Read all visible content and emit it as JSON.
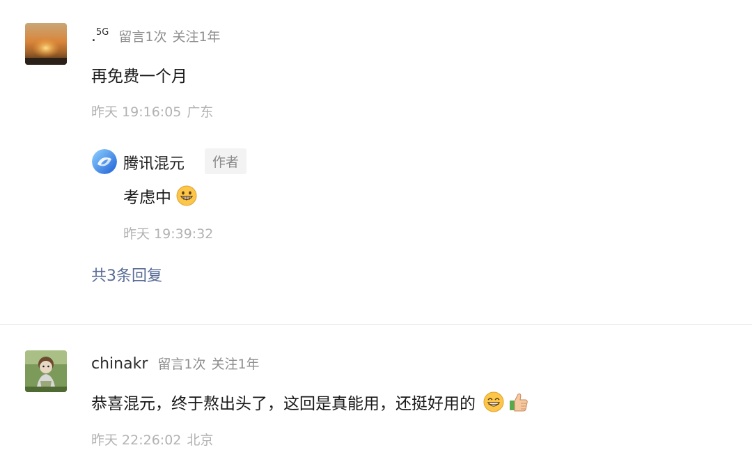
{
  "comments": [
    {
      "nickname": ".",
      "nickname_sup": "5G",
      "msg_count": "留言1次",
      "follow": "关注1年",
      "content": "再免费一个月",
      "time": "昨天 19:16:05",
      "location": "广东",
      "reply": {
        "name": "腾讯混元",
        "tag": "作者",
        "content": "考虑中",
        "emoji": "grinning-face-emoji",
        "time": "昨天 19:39:32"
      },
      "more_replies": "共3条回复"
    },
    {
      "nickname": "chinakr",
      "msg_count": "留言1次",
      "follow": "关注1年",
      "content": "恭喜混元，终于熬出头了，这回是真能用，还挺好用的",
      "emojis": [
        "smiling-face-emoji",
        "thumbs-up-emoji"
      ],
      "time": "昨天 22:26:02",
      "location": "北京"
    }
  ],
  "colors": {
    "link": "#576b95",
    "meta": "#8e8e8e",
    "time": "#b2b2b2",
    "divider": "#e6e6e6",
    "author_tag_bg": "#f3f3f3"
  }
}
